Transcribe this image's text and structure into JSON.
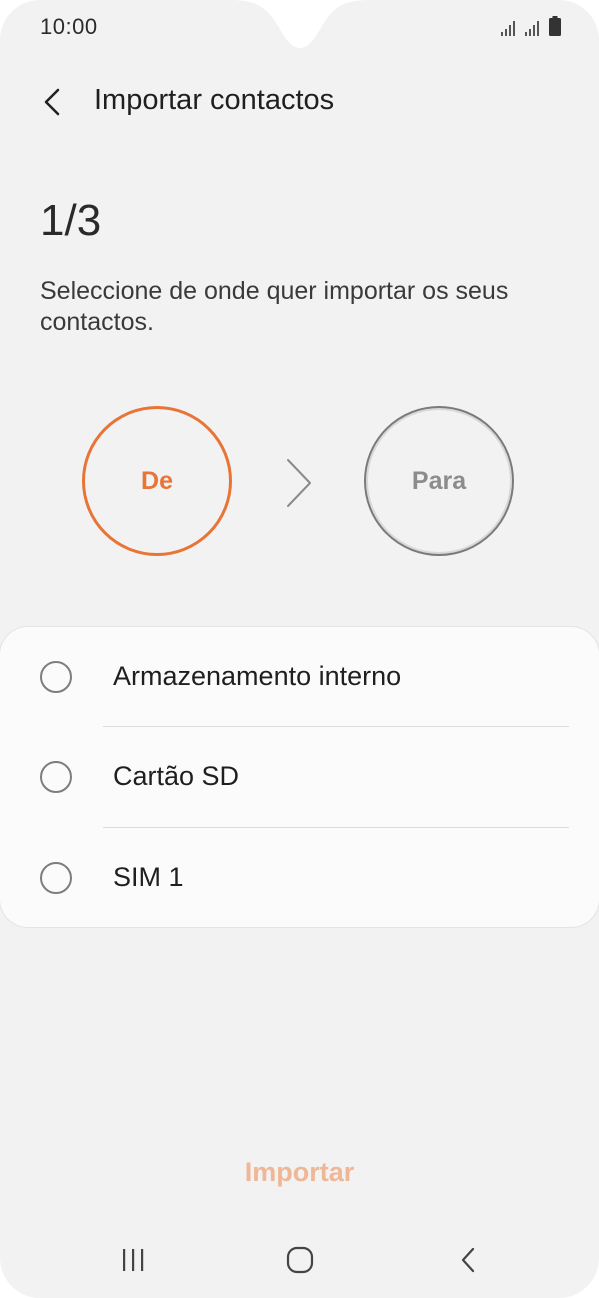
{
  "status_bar": {
    "time": "10:00",
    "icons": [
      "signal-sim1-icon",
      "signal-sim2-icon",
      "battery-icon"
    ]
  },
  "header": {
    "title": "Importar contactos",
    "back_icon": "chevron-left-icon"
  },
  "step": {
    "counter": "1/3",
    "instruction": "Seleccione de onde quer importar os seus contactos.",
    "from_label": "De",
    "to_label": "Para",
    "arrow_icon": "chevron-right-icon"
  },
  "options": [
    {
      "label": "Armazenamento interno",
      "selected": false
    },
    {
      "label": "Cartão SD",
      "selected": false
    },
    {
      "label": "SIM 1",
      "selected": false
    }
  ],
  "actions": {
    "import_label": "Importar"
  },
  "colors": {
    "accent": "#e87436",
    "accent_disabled": "#efb796",
    "background": "#f2f2f2",
    "card": "#fbfbfb"
  },
  "nav_bar": {
    "icons": [
      "recent-apps-icon",
      "home-icon",
      "back-icon"
    ]
  }
}
